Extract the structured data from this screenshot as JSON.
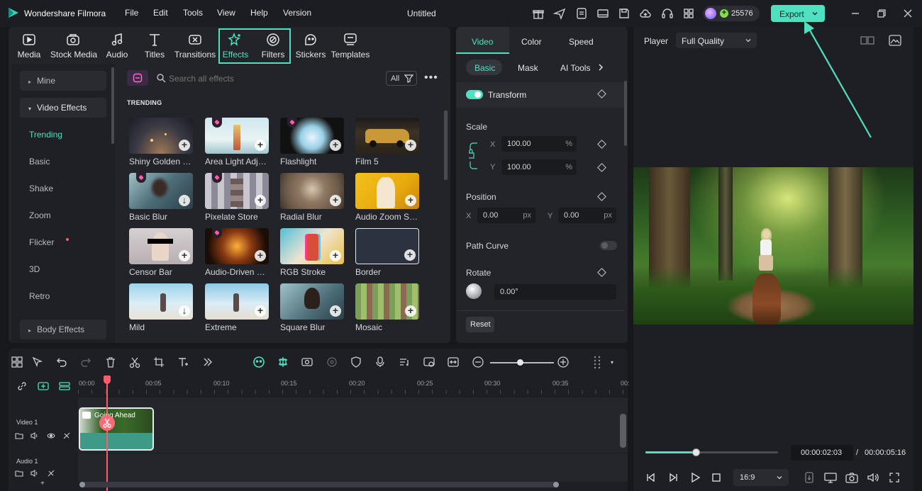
{
  "app": {
    "name": "Wondershare Filmora",
    "project_title": "Untitled",
    "credits": "25576",
    "export_label": "Export"
  },
  "menu": [
    "File",
    "Edit",
    "Tools",
    "View",
    "Help",
    "Version"
  ],
  "toolbar": [
    {
      "label": "Media",
      "icon": "media-icon"
    },
    {
      "label": "Stock Media",
      "icon": "stock-media-icon"
    },
    {
      "label": "Audio",
      "icon": "audio-icon"
    },
    {
      "label": "Titles",
      "icon": "titles-icon"
    },
    {
      "label": "Transitions",
      "icon": "transitions-icon"
    },
    {
      "label": "Effects",
      "icon": "effects-icon"
    },
    {
      "label": "Filters",
      "icon": "filters-icon"
    },
    {
      "label": "Stickers",
      "icon": "stickers-icon"
    },
    {
      "label": "Templates",
      "icon": "templates-icon"
    }
  ],
  "sidebar": {
    "mine": "Mine",
    "video_effects": "Video Effects",
    "items": [
      "Trending",
      "Basic",
      "Shake",
      "Zoom",
      "Flicker",
      "3D",
      "Retro"
    ],
    "body_effects": "Body Effects"
  },
  "search": {
    "placeholder": "Search all effects",
    "filter_label": "All"
  },
  "section_title": "TRENDING",
  "effects": [
    {
      "label": "Shiny Golden O...",
      "premium": false
    },
    {
      "label": "Area Light Adjust",
      "premium": true
    },
    {
      "label": "Flashlight",
      "premium": true
    },
    {
      "label": "Film 5",
      "premium": false
    },
    {
      "label": "Basic Blur",
      "premium": true
    },
    {
      "label": "Pixelate Store",
      "premium": true
    },
    {
      "label": "Radial Blur",
      "premium": false
    },
    {
      "label": "Audio Zoom Sq...",
      "premium": false
    },
    {
      "label": "Censor Bar",
      "premium": false
    },
    {
      "label": "Audio-Driven Ex...",
      "premium": true
    },
    {
      "label": "RGB Stroke",
      "premium": false
    },
    {
      "label": "Border",
      "premium": false
    },
    {
      "label": "Mild",
      "premium": false
    },
    {
      "label": "Extreme",
      "premium": false
    },
    {
      "label": "Square Blur",
      "premium": false
    },
    {
      "label": "Mosaic",
      "premium": false
    }
  ],
  "props": {
    "tabs": [
      "Video",
      "Color",
      "Speed"
    ],
    "subtabs": [
      "Basic",
      "Mask",
      "AI Tools"
    ],
    "transform_label": "Transform",
    "scale_label": "Scale",
    "scale_x_label": "X",
    "scale_y_label": "Y",
    "scale_x": "100.00",
    "scale_y": "100.00",
    "percent": "%",
    "position_label": "Position",
    "pos_x_label": "X",
    "pos_y_label": "Y",
    "pos_x": "0.00",
    "pos_y": "0.00",
    "px": "px",
    "path_curve_label": "Path Curve",
    "rotate_label": "Rotate",
    "rotate_value": "0.00°",
    "reset_label": "Reset"
  },
  "player": {
    "label": "Player",
    "quality": "Full Quality",
    "current_time": "00:00:02:03",
    "separator": "/",
    "total_time": "00:00:05:16",
    "aspect": "16:9",
    "progress": 0.38
  },
  "timeline": {
    "ruler": [
      "00:00",
      "00:05",
      "00:10",
      "00:15",
      "00:20",
      "00:25",
      "00:30",
      "00:35",
      "00:"
    ],
    "video_track": "Video 1",
    "audio_track": "Audio 1",
    "clip_title": "Going Ahead"
  },
  "colors": {
    "accent": "#4fe0c0",
    "playhead": "#ff5b6b",
    "clip": "#3c9a86"
  }
}
